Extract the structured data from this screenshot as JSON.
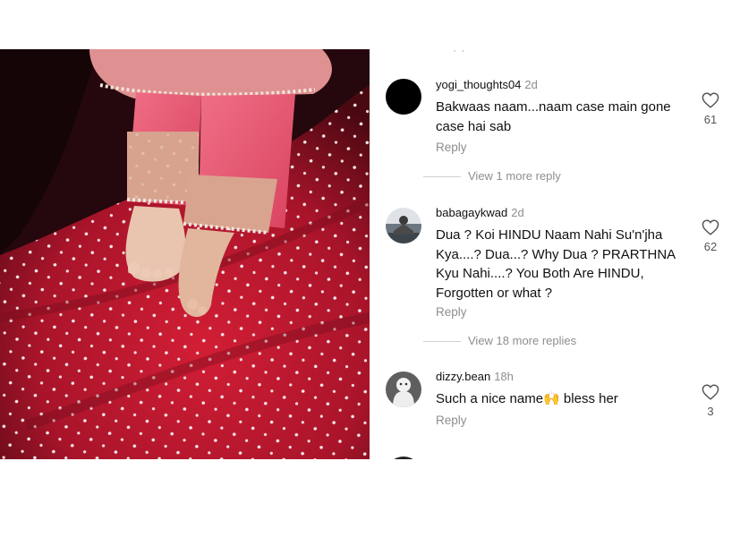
{
  "comments": [
    {
      "username": "yogi_thoughts04",
      "time": "2d",
      "text": "Bakwaas naam...naam case main gone case hai sab",
      "reply_label": "Reply",
      "likes": "61",
      "view_replies": "View 1 more reply",
      "avatar": "black-circle"
    },
    {
      "username": "babagaykwad",
      "time": "2d",
      "text": "Dua ? Koi HINDU Naam Nahi Su'n'jha Kya....? Dua...? Why Dua ? PRARTHNA Kyu Nahi....? You Both Are HINDU, Forgotten or what ?",
      "reply_label": "Reply",
      "likes": "62",
      "view_replies": "View 18 more replies",
      "avatar": "person-photo"
    },
    {
      "username": "dizzy.bean",
      "time": "18h",
      "text_before_emoji": "Such a nice name",
      "emoji": "🙌",
      "text_after_emoji": " bless her",
      "reply_label": "Reply",
      "likes": "3",
      "avatar": "ghost-figure"
    }
  ],
  "icons": {
    "like": "heart-outline-icon"
  },
  "colors": {
    "muted": "#8e8e8e",
    "text": "#111111",
    "fabric": "#b81a2e"
  }
}
